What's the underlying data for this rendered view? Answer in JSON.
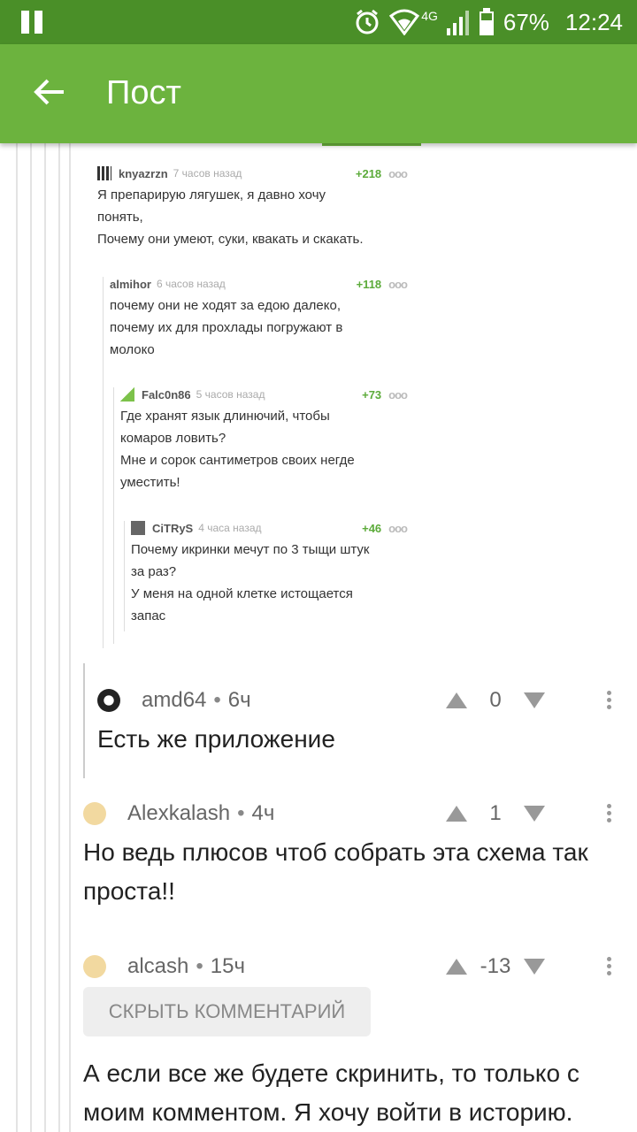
{
  "status_bar": {
    "battery": "67%",
    "time": "12:24",
    "network": "4G"
  },
  "app_bar": {
    "title": "Пост"
  },
  "screenshot_thread": [
    {
      "user": "knyazrzn",
      "time": "7 часов назад",
      "rating": "+218",
      "lines": [
        "Я препарирую лягушек, я давно хочу",
        "понять,",
        "Почему они умеют, суки, квакать и скакать."
      ]
    },
    {
      "user": "almihor",
      "time": "6 часов назад",
      "rating": "+118",
      "lines": [
        "почему они не ходят за едою далеко,",
        "почему их для прохлады погружают в",
        "молоко"
      ]
    },
    {
      "user": "Falc0n86",
      "time": "5 часов назад",
      "rating": "+73",
      "lines": [
        "Где хранят язык длинючий, чтобы",
        "комаров ловить?",
        "Мне и сорок сантиметров своих негде",
        "уместить!"
      ]
    },
    {
      "user": "CiTRyS",
      "time": "4 часа назад",
      "rating": "+46",
      "lines": [
        "Почему икринки мечут по 3 тыщи штук",
        "за раз?",
        "У меня на одной клетке истощается",
        "запас"
      ]
    }
  ],
  "comments": [
    {
      "user": "amd64",
      "time": "6ч",
      "score": "0",
      "text": "Есть же приложение"
    },
    {
      "user": "Alexkalash",
      "time": "4ч",
      "score": "1",
      "text": "Но ведь плюсов чтоб собрать эта схема так проста!!"
    },
    {
      "user": "alcash",
      "time": "15ч",
      "score": "-13",
      "hide_label": "СКРЫТЬ КОММЕНТАРИЙ",
      "text": "А если все же будете скринить, то только с моим комментом. Я хочу войти в историю."
    }
  ],
  "colors": {
    "status_bar": "#4a8f28",
    "app_bar": "#6cb33e",
    "rating_green": "#5cab3a"
  },
  "icons": [
    "pause-icon",
    "alarm-icon",
    "wifi-icon",
    "signal-icon",
    "battery-icon",
    "back-arrow-icon",
    "upvote-icon",
    "downvote-icon",
    "more-menu-icon"
  ]
}
